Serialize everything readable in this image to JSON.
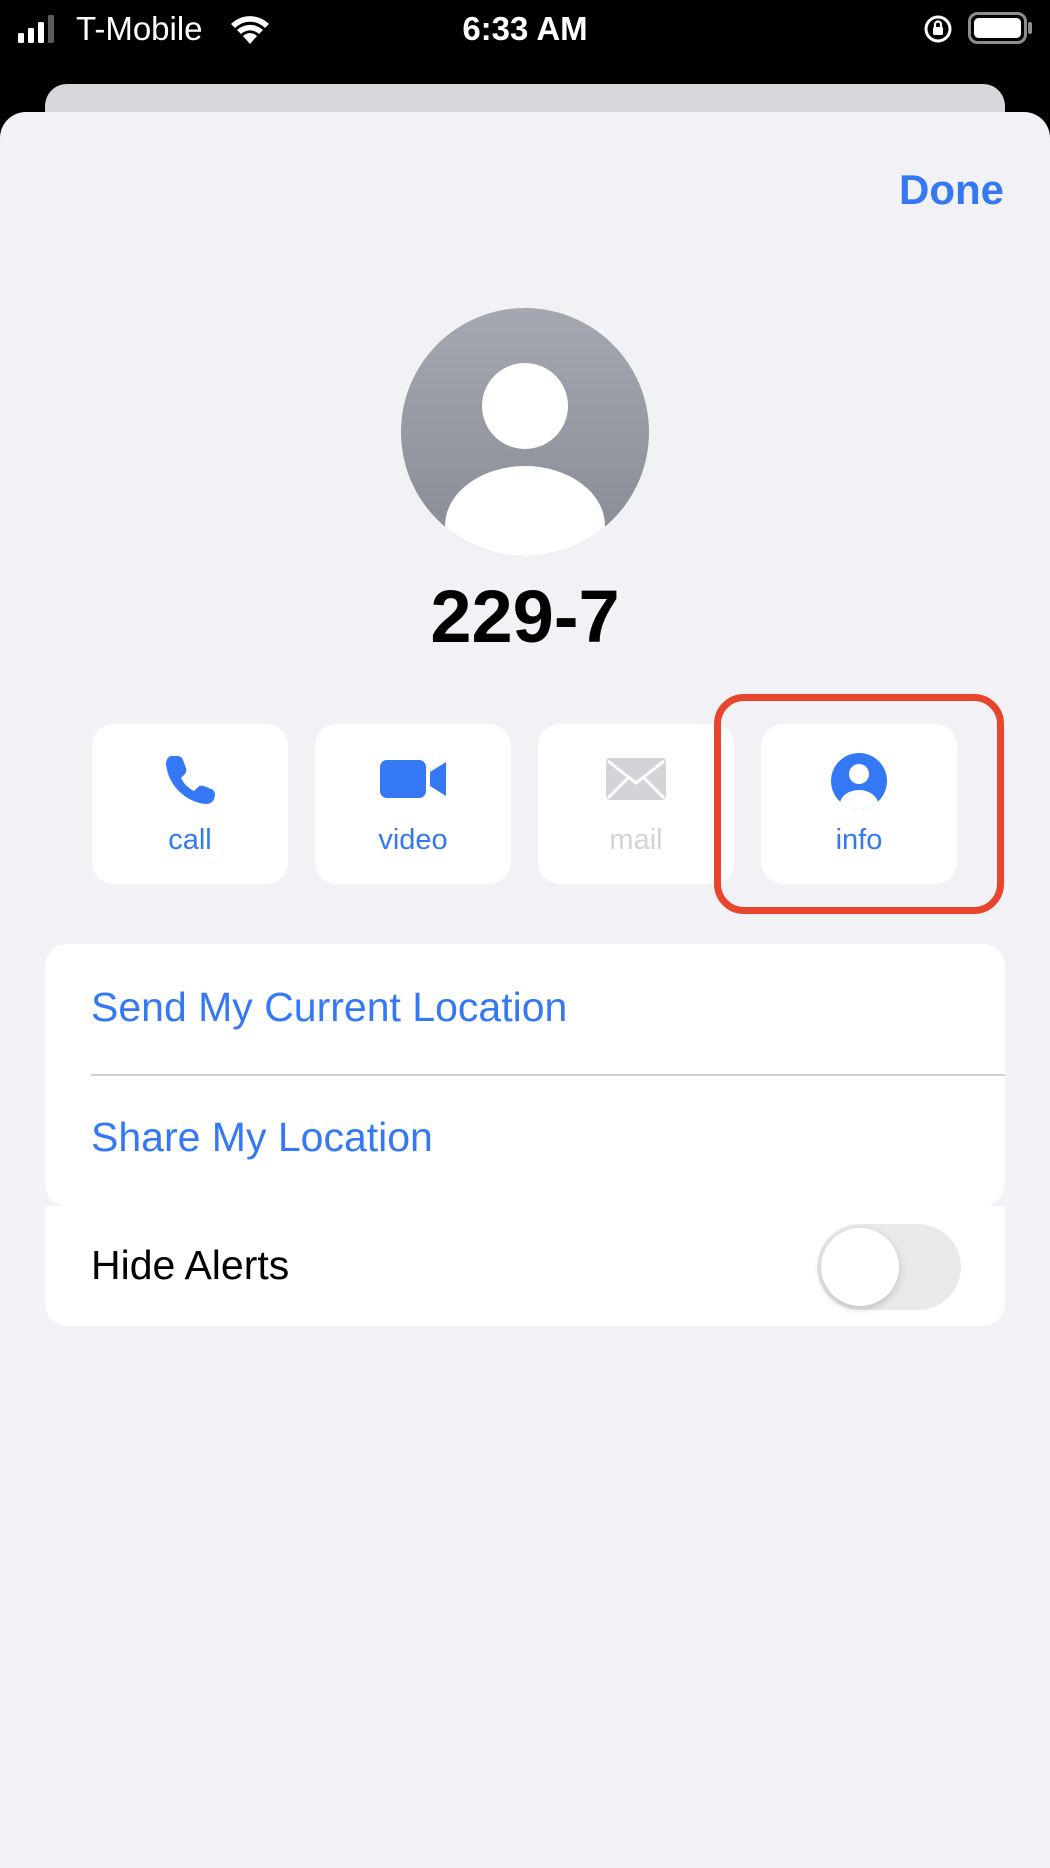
{
  "status_bar": {
    "carrier": "T-Mobile",
    "time": "6:33 AM",
    "icons": [
      "signal-bars-icon",
      "wifi-icon",
      "orientation-lock-icon",
      "battery-icon"
    ]
  },
  "header": {
    "done_label": "Done"
  },
  "contact": {
    "name": "229-7",
    "avatar_icon": "person-silhouette-icon"
  },
  "actions": [
    {
      "label": "call",
      "icon": "phone-icon",
      "enabled": true
    },
    {
      "label": "video",
      "icon": "video-camera-icon",
      "enabled": true
    },
    {
      "label": "mail",
      "icon": "envelope-icon",
      "enabled": false
    },
    {
      "label": "info",
      "icon": "person-circle-icon",
      "enabled": true
    }
  ],
  "location": {
    "send_current": "Send My Current Location",
    "share": "Share My Location"
  },
  "alerts": {
    "hide_alerts_label": "Hide Alerts",
    "hide_alerts_on": false
  },
  "colors": {
    "accent": "#3478f6",
    "highlight": "#e8452d",
    "sheet_background": "#f1f1f6"
  }
}
